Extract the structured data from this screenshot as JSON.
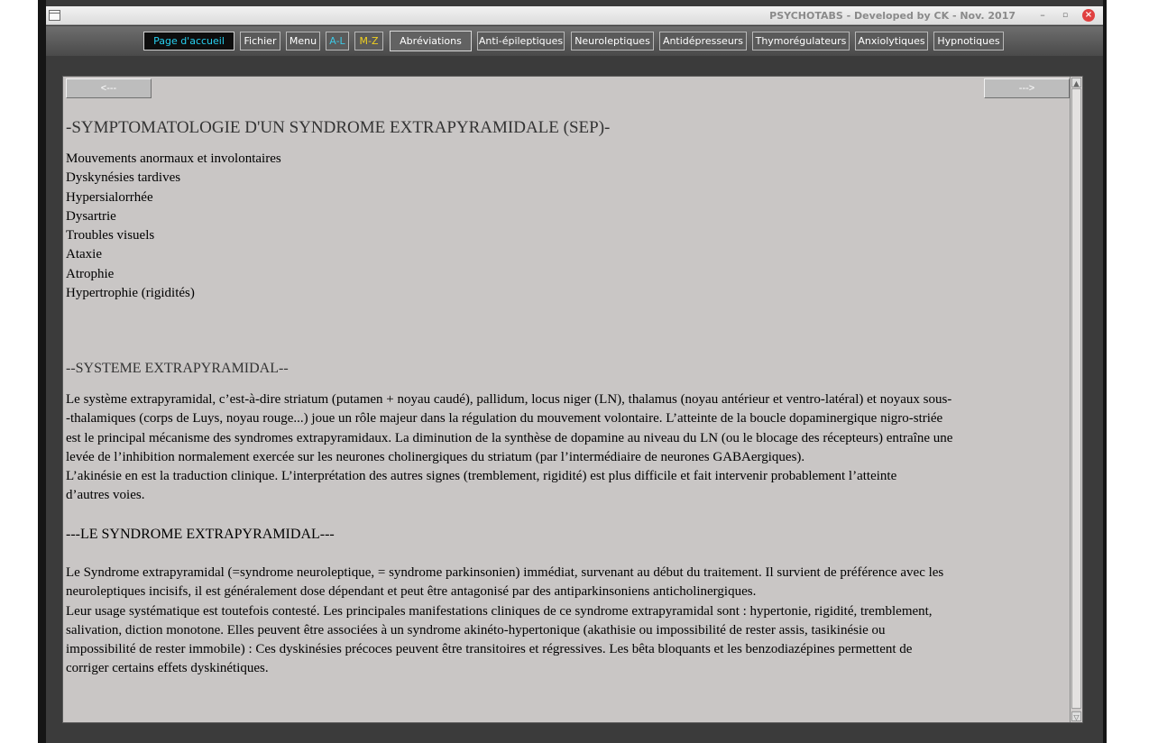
{
  "window": {
    "title": "PSYCHOTABS - Developed by CK - Nov. 2017",
    "minimize_glyph": "–",
    "maximize_glyph": "▫",
    "close_glyph": "×"
  },
  "toolbar": {
    "home": "Page d'accueil",
    "fichier": "Fichier",
    "menu": "Menu",
    "al": "A-L",
    "mz": "M-Z",
    "abbreviations": "Abréviations",
    "anti_epileptiques": "Anti-épileptiques",
    "neuroleptiques": "Neuroleptiques",
    "antidepresseurs": "Antidépresseurs",
    "thymoregulateurs": "Thymorégulateurs",
    "anxiolytiques": "Anxiolytiques",
    "hypnotiques": "Hypnotiques"
  },
  "nav": {
    "prev": "<---",
    "next": "--->"
  },
  "content": {
    "heading1": "-SYMPTOMATOLOGIE D'UN SYNDROME EXTRAPYRAMIDALE (SEP)-",
    "symptoms": [
      "Mouvements anormaux et involontaires",
      "Dyskynésies tardives",
      "Hypersialorrhée",
      "Dysartrie",
      "Troubles visuels",
      "Ataxie",
      "Atrophie",
      "Hypertrophie (rigidités)"
    ],
    "heading2": "--SYSTEME EXTRAPYRAMIDAL--",
    "paragraph1": [
      "Le système extrapyramidal, c’est-à-dire striatum (putamen + noyau caudé), pallidum, locus niger (LN), thalamus (noyau antérieur et ventro-latéral) et noyaux sous-",
      "-thalamiques  (corps  de  Luys, noyau rouge...) joue un rôle majeur dans la régulation du mouvement volontaire. L’atteinte de la boucle dopaminergique nigro-striée",
      "est le principal mécanisme des syndromes extrapyramidaux. La diminution de la synthèse de dopamine au niveau du LN (ou le blocage des récepteurs) entraîne une",
      "levée de l’inhibition normalement exercée sur les neurones cholinergiques du striatum (par l’intermédiaire de neurones GABAergiques).",
      "L’akinésie en est la traduction clinique. L’interprétation des autres signes (tremblement, rigidité) est plus difficile et fait intervenir probablement l’atteinte",
      "d’autres voies."
    ],
    "heading3": "---LE SYNDROME EXTRAPYRAMIDAL---",
    "paragraph2": [
      "Le Syndrome extrapyramidal (=syndrome neuroleptique, = syndrome parkinsonien) immédiat, survenant au début du traitement. Il survient de préférence avec les",
      "neuroleptiques incisifs, il est généralement dose dépendant et peut être antagonisé par des antiparkinsoniens anticholinergiques.",
      "Leur usage systématique est toutefois contesté. Les principales manifestations cliniques de ce syndrome extrapyramidal sont : hypertonie, rigidité, tremblement,",
      "salivation, diction monotone. Elles peuvent être associées à un syndrome akinéto-hypertonique (akathisie ou impossibilité de rester assis, tasikinésie ou",
      "impossibilité de rester immobile) : Ces dyskinésies précoces peuvent être transitoires et régressives. Les bêta bloquants et les benzodiazépines permettent de",
      "corriger certains effets dyskinétiques."
    ]
  },
  "scrollbar": {
    "up_glyph": "▲",
    "down_glyph": "▽"
  },
  "colors": {
    "home_text": "#27d0f0",
    "al_text": "#3dc9e6",
    "mz_text": "#f0d020",
    "content_bg": "#c9c6c5",
    "toolbar_bg": "#5a5a5a"
  }
}
